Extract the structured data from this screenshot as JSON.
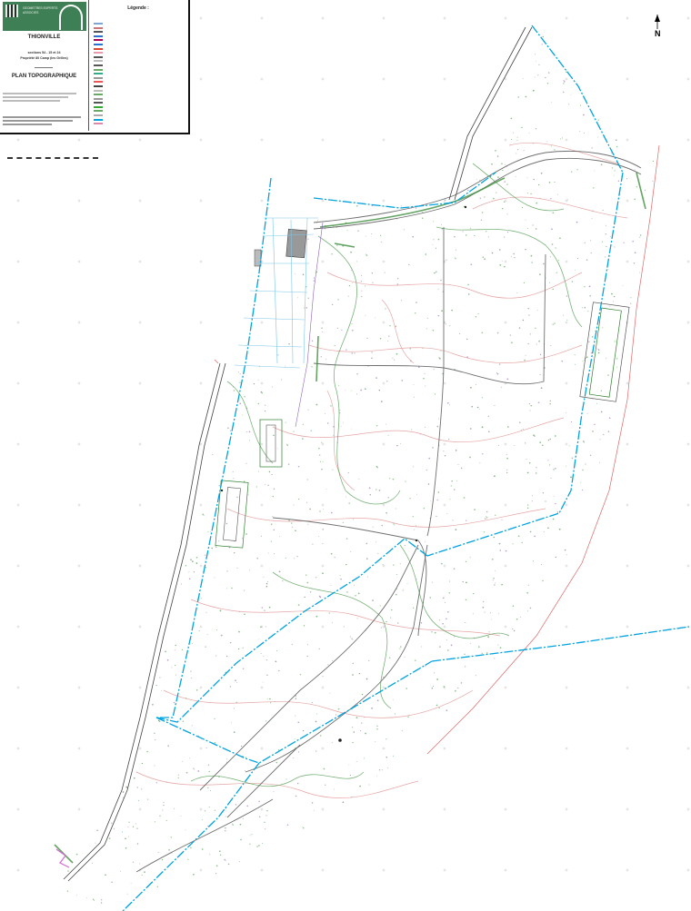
{
  "cartouche": {
    "logo_line1": "GEOMETRES EXPERTS",
    "logo_line2": "ASSOCIES",
    "city": "THIONVILLE",
    "subtitle1": "sections 54 - 15 et 24",
    "subtitle2": "Propriété 80 Camp (les Grilles)",
    "plan_title": "PLAN TOPOGRAPHIQUE"
  },
  "legend": {
    "title": "Légende :",
    "items": [
      {
        "color": "#7aa7d6",
        "text": ""
      },
      {
        "color": "#c77",
        "text": ""
      },
      {
        "color": "#555",
        "text": ""
      },
      {
        "color": "#2a6fd6",
        "text": ""
      },
      {
        "color": "#a05",
        "text": ""
      },
      {
        "color": "#2a6fd6",
        "text": ""
      },
      {
        "color": "#d43",
        "text": ""
      },
      {
        "color": "#e9a",
        "text": ""
      },
      {
        "color": "#555",
        "text": ""
      },
      {
        "color": "#bbb",
        "text": ""
      },
      {
        "color": "#555",
        "text": ""
      },
      {
        "color": "#6a6",
        "text": ""
      },
      {
        "color": "#3a8",
        "text": ""
      },
      {
        "color": "#999",
        "text": ""
      },
      {
        "color": "#e55",
        "text": ""
      },
      {
        "color": "#444",
        "text": ""
      },
      {
        "color": "#bbb",
        "text": ""
      },
      {
        "color": "#6a6",
        "text": ""
      },
      {
        "color": "#999",
        "text": ""
      },
      {
        "color": "#555",
        "text": ""
      },
      {
        "color": "#3a3",
        "text": ""
      },
      {
        "color": "#6a6",
        "text": ""
      },
      {
        "color": "#aaa",
        "text": ""
      },
      {
        "color": "#00a3e0",
        "text": ""
      },
      {
        "color": "#d8a",
        "text": ""
      }
    ]
  },
  "north_arrow": {
    "label": "N"
  },
  "colors": {
    "parcel_boundary": "#00a3e0",
    "vegetation": "#2e8b2e",
    "contours": "#e4a0a0",
    "road": "#777777",
    "background": "#ffffff"
  }
}
